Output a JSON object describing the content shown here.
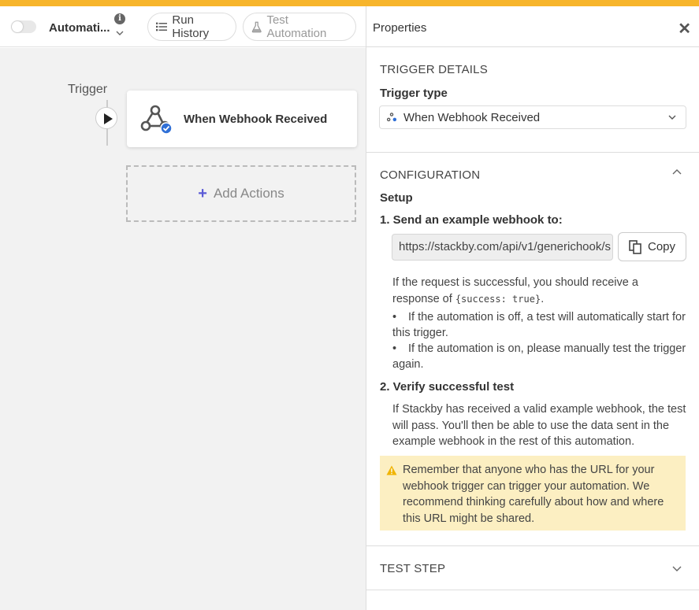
{
  "header": {
    "automation_name": "Automati...",
    "run_history_label": "Run History",
    "test_automation_label": "Test Automation"
  },
  "canvas": {
    "trigger_label": "Trigger",
    "trigger_card_title": "When Webhook Received",
    "add_actions_label": "Add Actions"
  },
  "properties": {
    "title": "Properties",
    "trigger_details": {
      "section_title": "TRIGGER DETAILS",
      "trigger_type_label": "Trigger type",
      "trigger_type_value": "When Webhook Received"
    },
    "configuration": {
      "section_title": "CONFIGURATION",
      "setup_label": "Setup",
      "step1_label": "1. Send an example webhook to:",
      "webhook_url": "https://stackby.com/api/v1/generichook/s",
      "copy_label": "Copy",
      "response_text_a": "If the request is successful, you should receive a response of",
      "response_code": "{success: true}",
      "response_text_b": ".",
      "bullet_off": "If the automation is off, a test will automatically start for this trigger.",
      "bullet_on": "If the automation is on, please manually test the trigger again.",
      "step2_label": "2. Verify successful test",
      "verify_text": "If Stackby has received a valid example webhook, the test will pass. You'll then be able to use the data sent in the example webhook in the rest of this automation.",
      "warning_text": "Remember that anyone who has the URL for your webhook trigger can trigger your automation. We recommend thinking carefully about how and where this URL might be shared."
    },
    "test_step": {
      "section_title": "TEST STEP"
    }
  },
  "colors": {
    "accent_bar": "#f7b52c",
    "warning_bg": "#fcefc2",
    "add_plus": "#5b5bd6"
  }
}
